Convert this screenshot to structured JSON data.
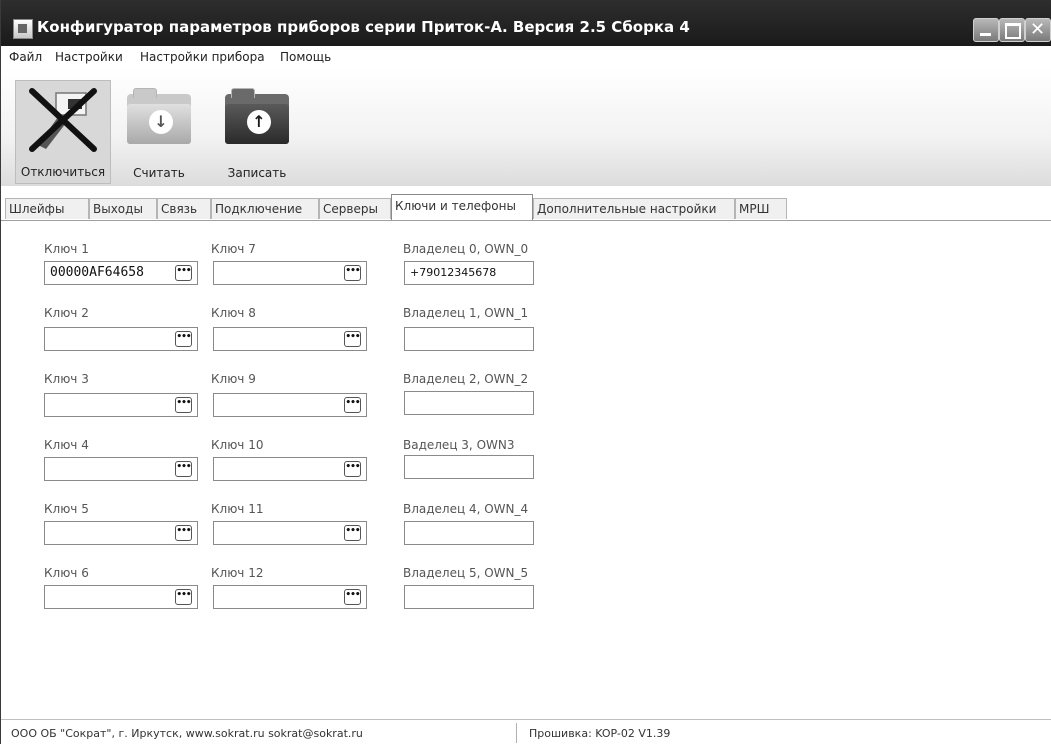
{
  "window": {
    "title": "Конфигуратор параметров приборов серии Приток-А. Версия 2.5 Сборка 4"
  },
  "menu": [
    "Файл",
    "Настройки",
    "Настройки прибора",
    "Помощь"
  ],
  "toolbar": {
    "disconnect_label": "Отключиться",
    "read_label": "Считать",
    "write_label": "Записать"
  },
  "tabs": [
    "Шлейфы",
    "Выходы",
    "Связь",
    "Подключение",
    "Серверы",
    "Ключи и телефоны",
    "Дополнительные настройки",
    "МРШ"
  ],
  "active_tab": "Ключи и телефоны",
  "keys_col1": [
    {
      "label": "Ключ 1",
      "value": "00000AF64658"
    },
    {
      "label": "Ключ 2",
      "value": ""
    },
    {
      "label": "Ключ 3",
      "value": ""
    },
    {
      "label": "Ключ 4",
      "value": ""
    },
    {
      "label": "Ключ 5",
      "value": ""
    },
    {
      "label": "Ключ 6",
      "value": ""
    }
  ],
  "keys_col2": [
    {
      "label": "Ключ 7",
      "value": ""
    },
    {
      "label": "Ключ 8",
      "value": ""
    },
    {
      "label": "Ключ 9",
      "value": ""
    },
    {
      "label": "Ключ 10",
      "value": ""
    },
    {
      "label": "Ключ 11",
      "value": ""
    },
    {
      "label": "Ключ 12",
      "value": ""
    }
  ],
  "owners": [
    {
      "label": "Владелец 0, OWN_0",
      "value": "+79012345678"
    },
    {
      "label": "Владелец 1, OWN_1",
      "value": ""
    },
    {
      "label": "Владелец 2, OWN_2",
      "value": ""
    },
    {
      "label": "Ваделец 3, OWN3",
      "value": ""
    },
    {
      "label": "Владелец 4, OWN_4",
      "value": ""
    },
    {
      "label": "Владелец 5, OWN_5",
      "value": ""
    }
  ],
  "browse_button_label": "•••",
  "status": {
    "company": "ООО ОБ \"Сократ\", г. Иркутск,  www.sokrat.ru  sokrat@sokrat.ru",
    "firmware": "Прошивка: KOP-02 V1.39"
  }
}
